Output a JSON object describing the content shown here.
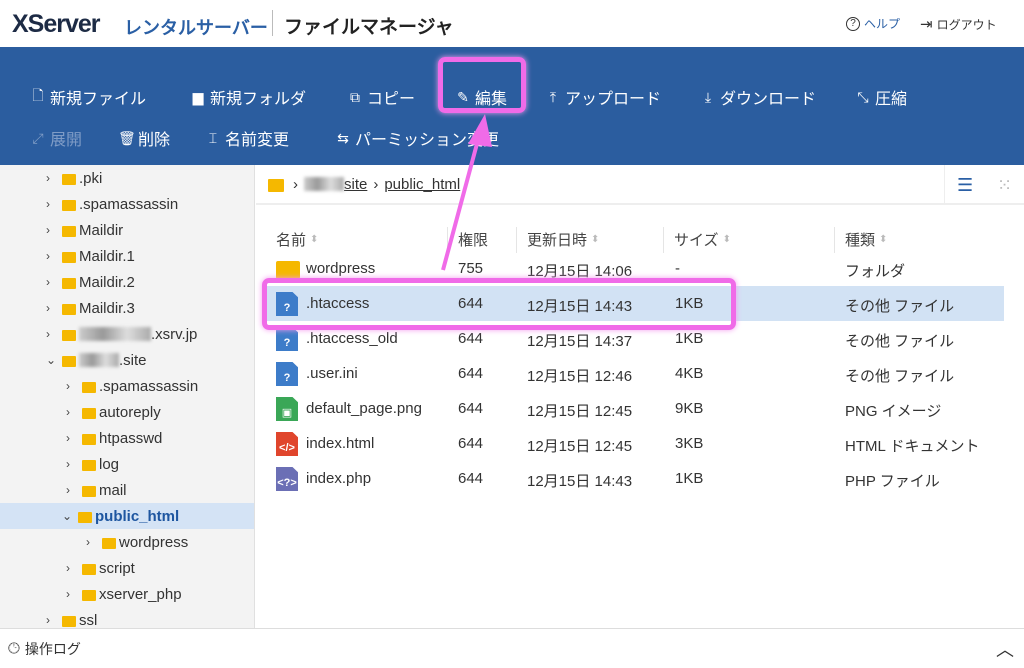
{
  "header": {
    "logo": "XServer",
    "logo_sub": "レンタルサーバー",
    "title": "ファイルマネージャ",
    "help": "ヘルプ",
    "logout": "ログアウト"
  },
  "toolbar": {
    "row1": [
      {
        "icon": "new-file-icon",
        "label": "新規ファイル"
      },
      {
        "icon": "new-folder-icon",
        "label": "新規フォルダ"
      },
      {
        "icon": "copy-icon",
        "label": "コピー"
      },
      {
        "icon": "pencil-icon",
        "label": "編集"
      },
      {
        "icon": "upload-icon",
        "label": "アップロード"
      },
      {
        "icon": "download-icon",
        "label": "ダウンロード"
      },
      {
        "icon": "compress-icon",
        "label": "圧縮"
      }
    ],
    "row2": [
      {
        "icon": "extract-icon",
        "label": "展開",
        "disabled": true
      },
      {
        "icon": "trash-icon",
        "label": "削除"
      },
      {
        "icon": "rename-icon",
        "label": "名前変更"
      },
      {
        "icon": "permission-icon",
        "label": "パーミッション変更"
      }
    ]
  },
  "tree": [
    {
      "label": ".pki",
      "level": 1
    },
    {
      "label": ".spamassassin",
      "level": 1
    },
    {
      "label": "Maildir",
      "level": 1
    },
    {
      "label": "Maildir.1",
      "level": 1
    },
    {
      "label": "Maildir.2",
      "level": 1
    },
    {
      "label": "Maildir.3",
      "level": 1
    },
    {
      "label": ".xsrv.jp",
      "level": 1,
      "blurred_prefix": true
    },
    {
      "label": ".site",
      "level": 1,
      "blurred_prefix": true,
      "expanded": true
    },
    {
      "label": ".spamassassin",
      "level": 2
    },
    {
      "label": "autoreply",
      "level": 2
    },
    {
      "label": "htpasswd",
      "level": 2
    },
    {
      "label": "log",
      "level": 2
    },
    {
      "label": "mail",
      "level": 2
    },
    {
      "label": "public_html",
      "level": 2,
      "expanded": true,
      "selected": true
    },
    {
      "label": "wordpress",
      "level": 3
    },
    {
      "label": "script",
      "level": 2
    },
    {
      "label": "xserver_php",
      "level": 2
    },
    {
      "label": "ssl",
      "level": 1
    }
  ],
  "breadcrumb": {
    "site": "site",
    "current": "public_html"
  },
  "columns": {
    "name": "名前",
    "perm": "権限",
    "date": "更新日時",
    "size": "サイズ",
    "type": "種類"
  },
  "files": [
    {
      "name": "wordpress",
      "perm": "755",
      "date": "12月15日 14:06",
      "size": "-",
      "type": "フォルダ",
      "icon": "folder"
    },
    {
      "name": ".htaccess",
      "perm": "644",
      "date": "12月15日 14:43",
      "size": "1KB",
      "type": "その他 ファイル",
      "icon": "unknown",
      "selected": true
    },
    {
      "name": ".htaccess_old",
      "perm": "644",
      "date": "12月15日 14:37",
      "size": "1KB",
      "type": "その他 ファイル",
      "icon": "unknown"
    },
    {
      "name": ".user.ini",
      "perm": "644",
      "date": "12月15日 12:46",
      "size": "4KB",
      "type": "その他 ファイル",
      "icon": "unknown"
    },
    {
      "name": "default_page.png",
      "perm": "644",
      "date": "12月15日 12:45",
      "size": "9KB",
      "type": "PNG イメージ",
      "icon": "image"
    },
    {
      "name": "index.html",
      "perm": "644",
      "date": "12月15日 12:45",
      "size": "3KB",
      "type": "HTML ドキュメント",
      "icon": "html"
    },
    {
      "name": "index.php",
      "perm": "644",
      "date": "12月15日 14:43",
      "size": "1KB",
      "type": "PHP ファイル",
      "icon": "php"
    }
  ],
  "footer": {
    "log": "操作ログ"
  },
  "colors": {
    "toolbar": "#2b5d9f",
    "highlight": "#f06be8",
    "selected_row": "#d2e2f4"
  }
}
